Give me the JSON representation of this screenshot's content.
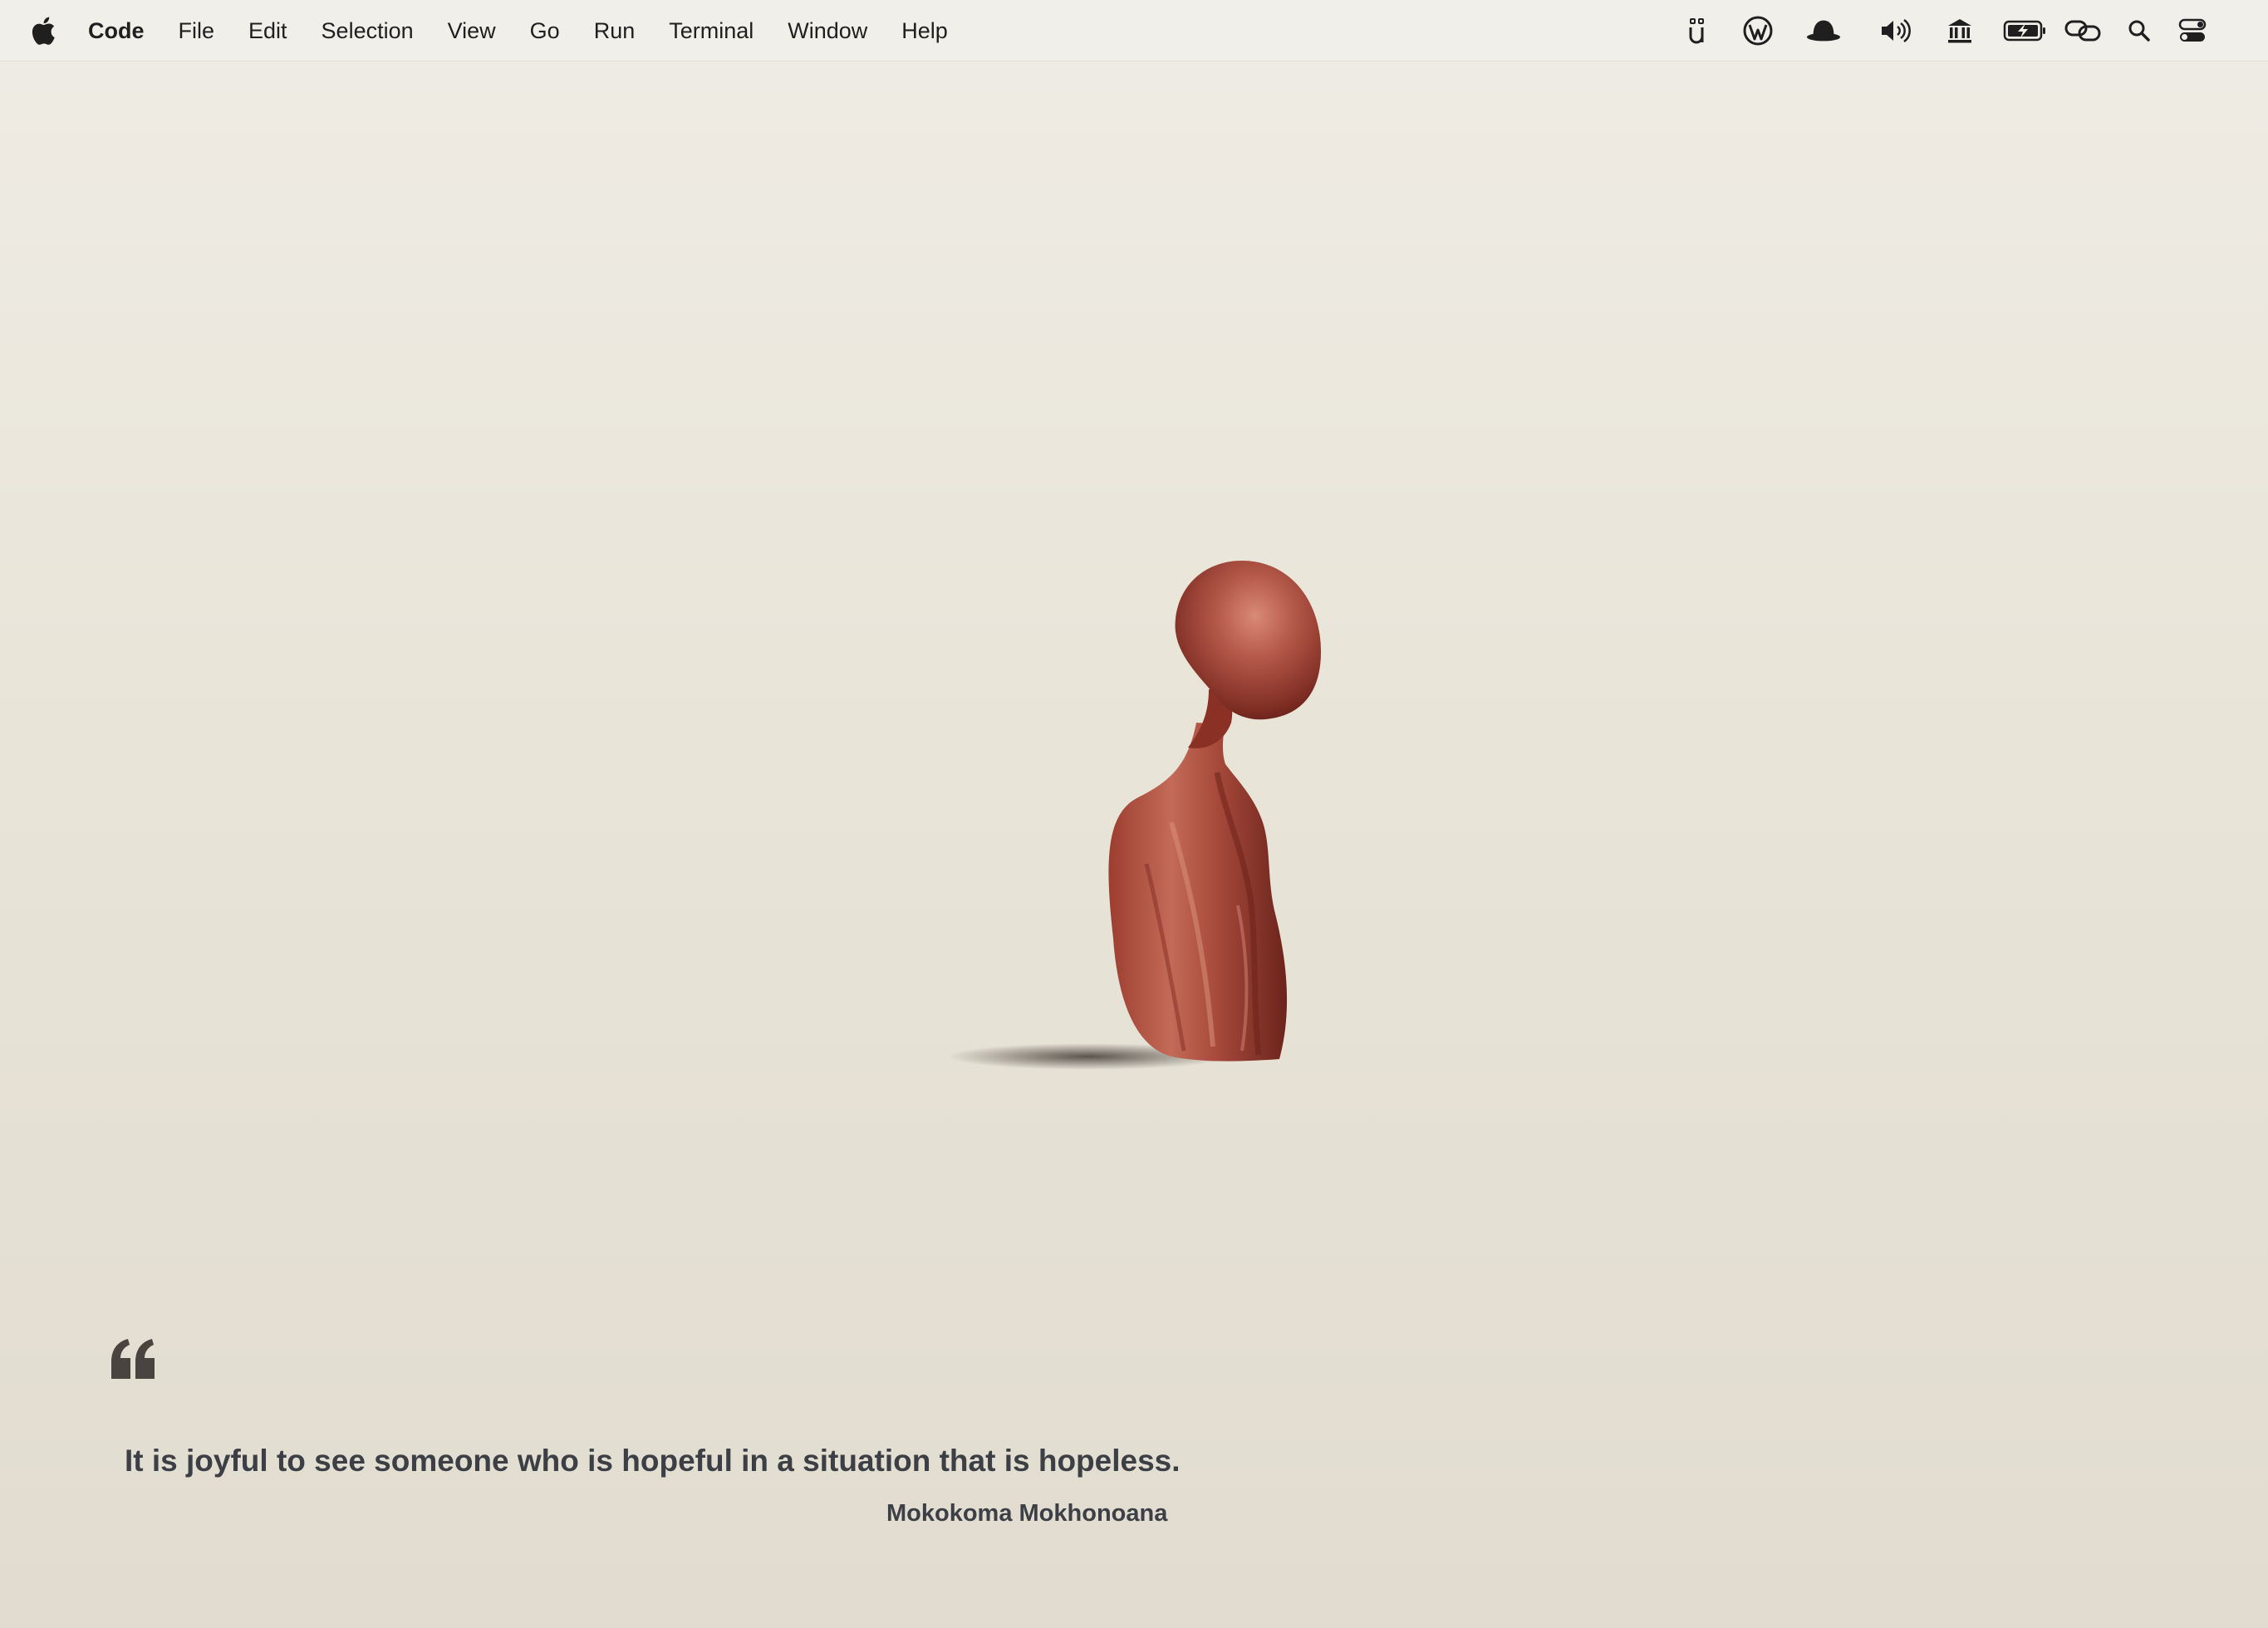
{
  "menubar": {
    "apple_icon": "apple-logo-icon",
    "app_name": "Code",
    "menus": [
      "File",
      "Edit",
      "Selection",
      "View",
      "Go",
      "Run",
      "Terminal",
      "Window",
      "Help"
    ],
    "tray_icons": [
      "ublock-icon",
      "wordpress-icon",
      "bowler-hat-icon",
      "volume-icon",
      "bank-icon",
      "battery-charging-icon",
      "link-icon",
      "spotlight-search-icon",
      "control-center-icon"
    ]
  },
  "wallpaper": {
    "sculpture_color": "#a4473a"
  },
  "quote": {
    "text": "It is joyful to see someone who is hopeful in a situation that is hopeless.",
    "author": "Mokokoma Mokhonoana"
  }
}
